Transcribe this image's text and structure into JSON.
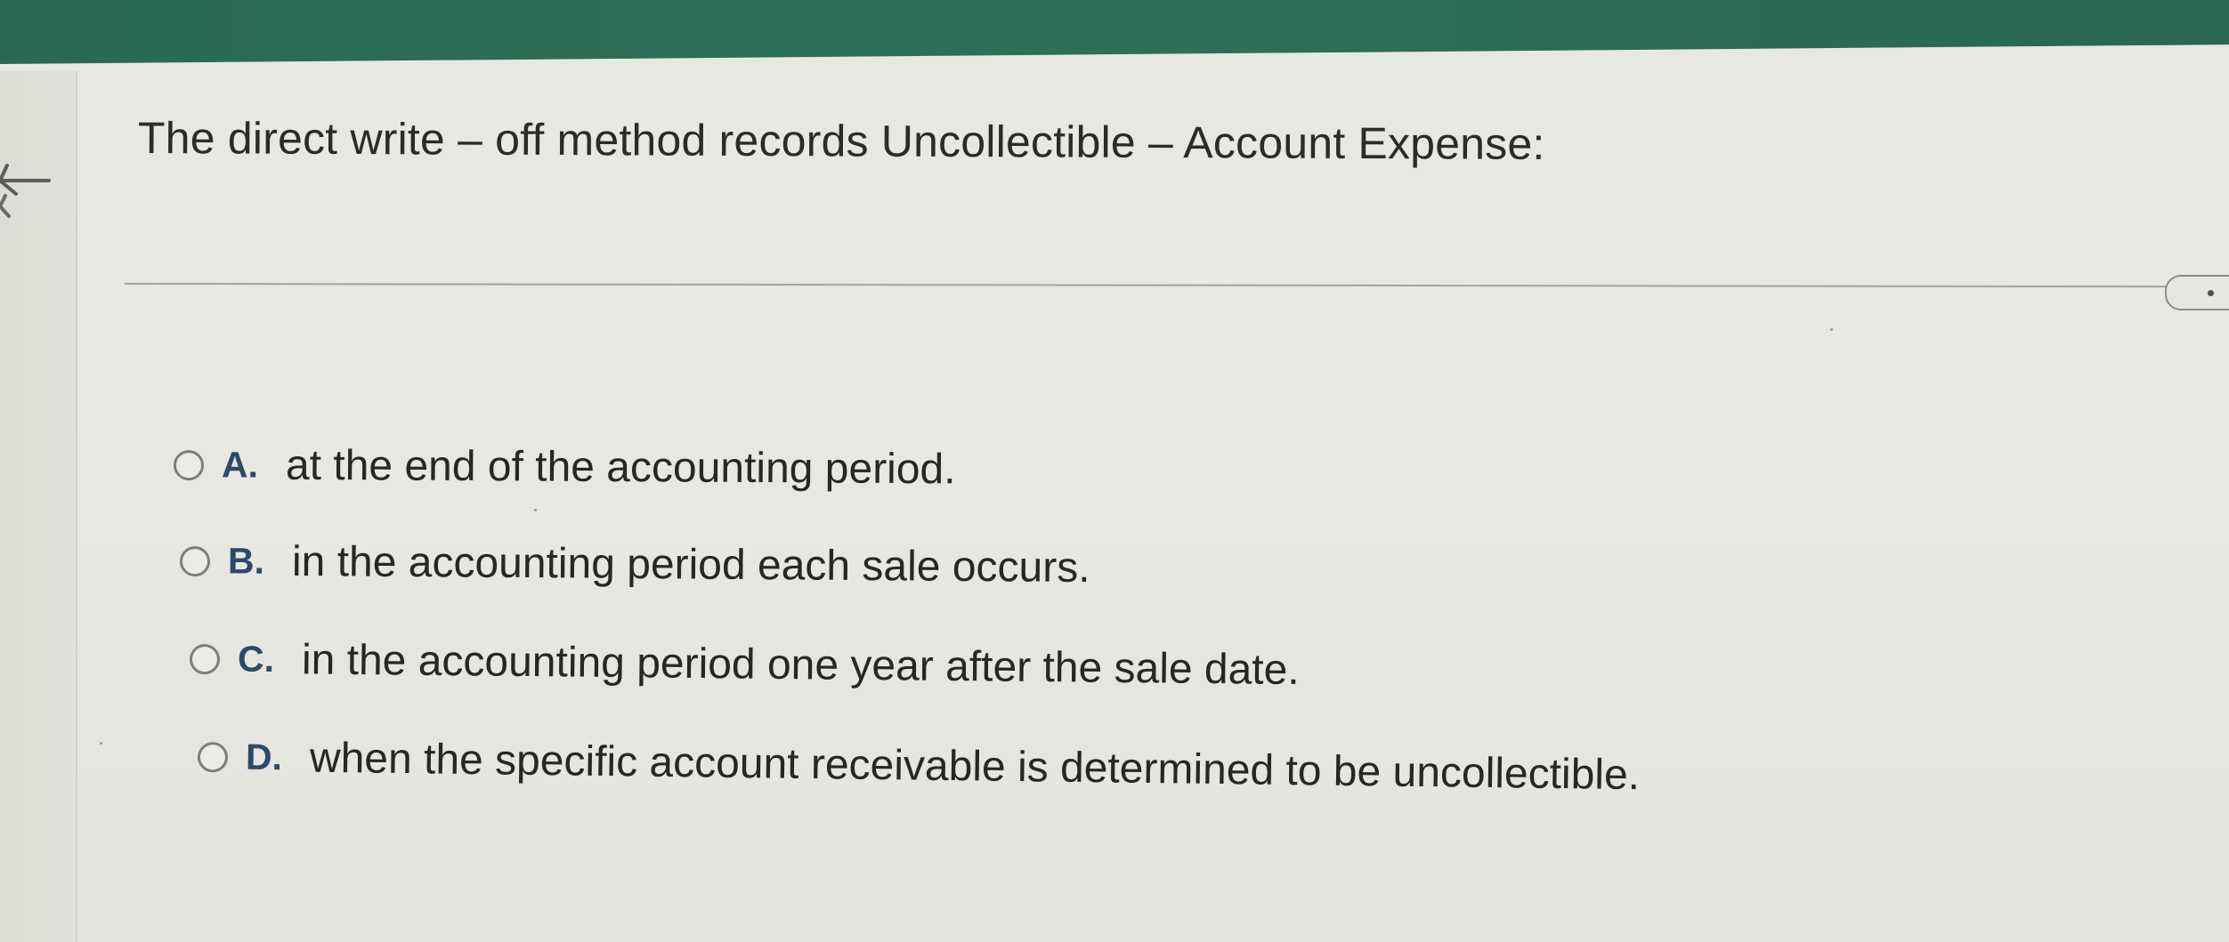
{
  "question": {
    "text": "The direct write – off method records Uncollectible – Account Expense:"
  },
  "icons": {
    "back": "back-arrow-icon",
    "toggle": "toggle-icon"
  },
  "options": [
    {
      "letter": "A.",
      "text": "at the end of the accounting period."
    },
    {
      "letter": "B.",
      "text": "in the accounting period each sale occurs."
    },
    {
      "letter": "C.",
      "text": "in the accounting period one year after the sale date."
    },
    {
      "letter": "D.",
      "text": "when the specific account receivable is determined to be uncollectible."
    }
  ],
  "colors": {
    "top_bar": "#2d7058",
    "option_letter": "#2c4a6a",
    "text": "#272727"
  }
}
